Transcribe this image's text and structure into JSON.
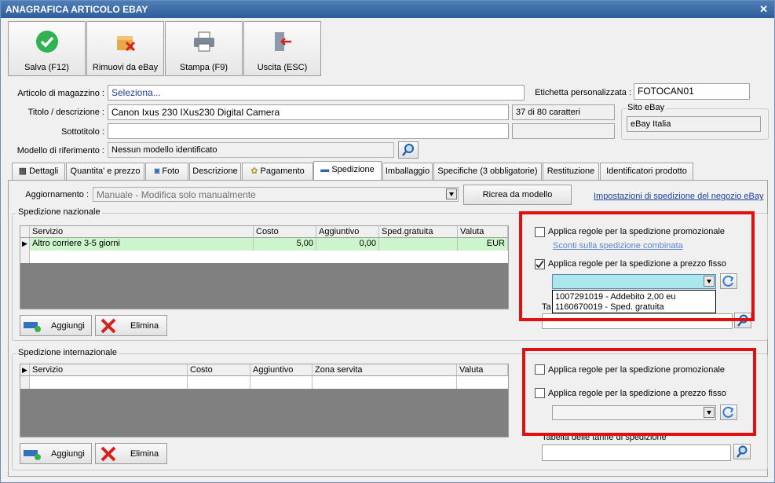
{
  "title": "ANAGRAFICA ARTICOLO EBAY",
  "toolbar": {
    "save": "Salva (F12)",
    "remove": "Rimuovi da eBay",
    "print": "Stampa (F9)",
    "exit": "Uscita (ESC)"
  },
  "form": {
    "articolo_label": "Articolo di magazzino :",
    "articolo_value": "Seleziona...",
    "etichetta_label": "Etichetta personalizzata :",
    "etichetta_value": "FOTOCAN01",
    "titolo_label": "Titolo / descrizione :",
    "titolo_value": "Canon Ixus 230 IXus230 Digital Camera",
    "titolo_count": "37 di 80 caratteri",
    "sito_label": "Sito eBay",
    "sito_value": "eBay Italia",
    "sottotitolo_label": "Sottotitolo :",
    "modello_label": "Modello di riferimento :",
    "modello_value": "Nessun modello identificato"
  },
  "tabs": [
    "Dettagli",
    "Quantita' e prezzo",
    "Foto",
    "Descrizione",
    "Pagamento",
    "Spedizione",
    "Imballaggio",
    "Specifiche (3 obbligatorie)",
    "Restituzione",
    "Identificatori prodotto"
  ],
  "aggiornamento": {
    "label": "Aggiornamento :",
    "value": "Manuale - Modifica solo manualmente",
    "ricrea": "Ricrea da modello",
    "link": "Impostazioni di spedizione del negozio eBay"
  },
  "nazionale": {
    "title": "Spedizione nazionale",
    "cols": [
      "Servizio",
      "Costo",
      "Aggiuntivo",
      "Sped.gratuita",
      "Valuta"
    ],
    "row": {
      "servizio": "Altro corriere 3-5 giorni",
      "costo": "5,00",
      "aggiuntivo": "0,00",
      "gratuita": "",
      "valuta": "EUR"
    },
    "add": "Aggiungi",
    "delete": "Elimina",
    "promo": "Applica regole per la spedizione promozionale",
    "sconti": "Sconti sulla spedizione combinata",
    "fisso": "Applica regole per la spedizione a prezzo fisso",
    "options": [
      "1007291019 - Addebito 2,00 eu",
      "1160670019 - Sped. gratuita"
    ],
    "tabella_label": "Ta"
  },
  "internazionale": {
    "title": "Spedizione internazionale",
    "cols": [
      "Servizio",
      "Costo",
      "Aggiuntivo",
      "Zona servita",
      "Valuta"
    ],
    "add": "Aggiungi",
    "delete": "Elimina",
    "promo": "Applica regole per la spedizione promozionale",
    "fisso": "Applica regole per la spedizione a prezzo fisso",
    "tabella_label": "Tabella delle tariffe di spedizione"
  }
}
